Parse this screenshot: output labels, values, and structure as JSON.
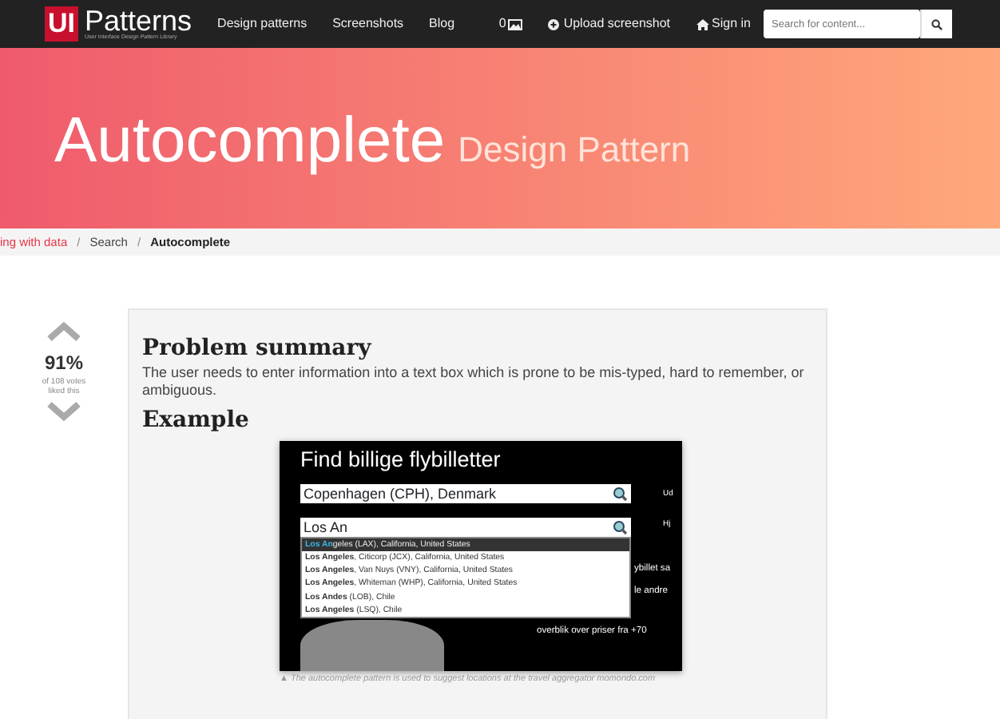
{
  "navbar": {
    "logo_mark": "UI",
    "logo_text": "Patterns",
    "logo_tagline": "User Interface Design Pattern Library",
    "links": [
      "Design patterns",
      "Screenshots",
      "Blog"
    ],
    "screenshot_count": "0",
    "upload": "Upload screenshot",
    "sign_in": "Sign in",
    "search": {
      "placeholder": "Search for content..."
    }
  },
  "hero": {
    "title": "Autocomplete",
    "subtitle": "Design Pattern"
  },
  "breadcrumb": {
    "items": [
      {
        "label": "ing with data",
        "current": false
      },
      {
        "label": "Search",
        "current": false
      },
      {
        "label": "Autocomplete",
        "current": true
      }
    ],
    "separators": [
      "/",
      "/"
    ]
  },
  "vote": {
    "percent": "91%",
    "votes": "of 108 votes",
    "caption": "liked this"
  },
  "problem": {
    "heading": "Problem summary",
    "text": "The user needs to enter information into a text box which is prone to be mis-typed, hard to remember, or ambiguous."
  },
  "example": {
    "heading": "Example",
    "screenshot": {
      "title": "Find billige flybilletter",
      "from_value": "Copenhagen (CPH), Denmark",
      "to_value": "Los An",
      "side_labels": [
        "Ud",
        "Hj"
      ],
      "suggestions": [
        {
          "text": "**Los An**geles (LAX), California, United States",
          "selected": true
        },
        {
          "text": "**Los Angeles**, Citicorp (JCX), California, United States",
          "selected": false
        },
        {
          "text": "**Los Angeles**, Van Nuys (VNY), California, United States",
          "selected": false
        },
        {
          "text": "**Los Angeles**, Whiteman (WHP), California, United States",
          "selected": false
        },
        {
          "text": "**Los Andes** (LOB), Chile",
          "selected": false
        },
        {
          "text": "**Los Angeles** (LSQ), Chile",
          "selected": false
        }
      ],
      "promo_lines": [
        "ybillet sa",
        "le andre",
        "overblik over priser fra +70"
      ]
    },
    "caption": "▲ The autocomplete pattern is used to suggest locations at the travel aggregator momondo.com"
  }
}
